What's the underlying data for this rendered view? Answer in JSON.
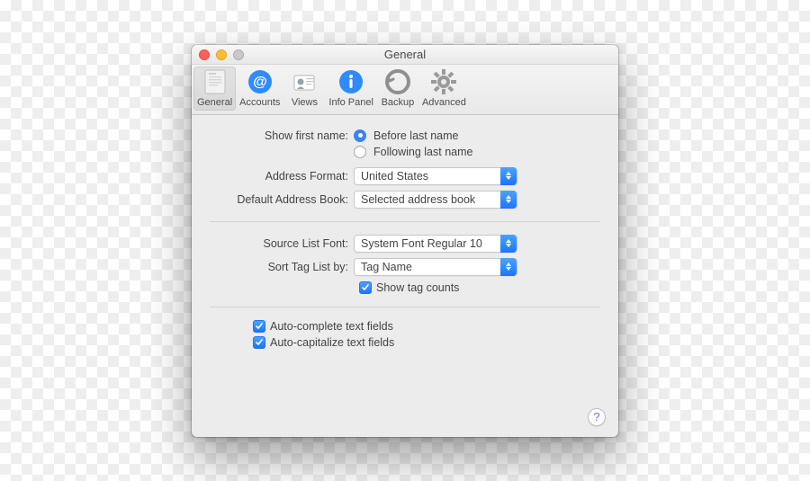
{
  "window": {
    "title": "General"
  },
  "toolbar": {
    "items": [
      {
        "id": "general",
        "label": "General"
      },
      {
        "id": "accounts",
        "label": "Accounts"
      },
      {
        "id": "views",
        "label": "Views"
      },
      {
        "id": "infopanel",
        "label": "Info Panel"
      },
      {
        "id": "backup",
        "label": "Backup"
      },
      {
        "id": "advanced",
        "label": "Advanced"
      }
    ],
    "selected": "general"
  },
  "section1": {
    "show_first_name_label": "Show first name:",
    "first_name_options": {
      "before": "Before last name",
      "following": "Following last name",
      "selected": "before"
    },
    "address_format_label": "Address Format:",
    "address_format_value": "United States",
    "default_book_label": "Default Address Book:",
    "default_book_value": "Selected address book"
  },
  "section2": {
    "source_font_label": "Source List Font:",
    "source_font_value": "System Font Regular 10",
    "sort_tag_label": "Sort Tag List by:",
    "sort_tag_value": "Tag Name",
    "show_tag_counts_label": "Show tag counts",
    "show_tag_counts_checked": true
  },
  "section3": {
    "autocomplete_label": "Auto-complete text fields",
    "autocomplete_checked": true,
    "autocapitalize_label": "Auto-capitalize text fields",
    "autocapitalize_checked": true
  },
  "help_tooltip": "?"
}
